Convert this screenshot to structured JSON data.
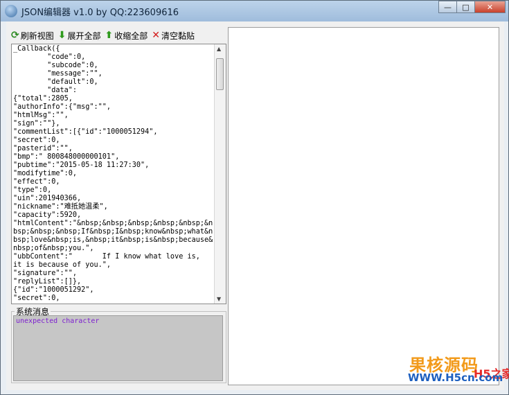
{
  "window": {
    "title": "JSON编辑器 v1.0  by  QQ:223609616",
    "minimize": "—",
    "maximize": "□",
    "close": "✕"
  },
  "toolbar": {
    "refresh_label": "刷新视图",
    "expand_label": "展开全部",
    "collapse_label": "收缩全部",
    "clear_label": "清空黏贴",
    "icons": {
      "refresh": "refresh-icon",
      "expand": "arrow-down-icon",
      "collapse": "arrow-up-icon",
      "clear": "close-icon"
    }
  },
  "editor": {
    "text": "_Callback({\n        \"code\":0,\n        \"subcode\":0,\n        \"message\":\"\",\n        \"default\":0,\n        \"data\":\n{\"total\":2805,\n\"authorInfo\":{\"msg\":\"\",\n\"htmlMsg\":\"\",\n\"sign\":\"\"},\n\"commentList\":[{\"id\":\"1000051294\",\n\"secret\":0,\n\"pasterid\":\"\",\n\"bmp\":\" 800848000000101\",\n\"pubtime\":\"2015-05-18 11:27:30\",\n\"modifytime\":0,\n\"effect\":0,\n\"type\":0,\n\"uin\":201940366,\n\"nickname\":\"难抵她温柔\",\n\"capacity\":5920,\n\"htmlContent\":\"&nbsp;&nbsp;&nbsp;&nbsp;&nbsp;&n\nbsp;&nbsp;&nbsp;If&nbsp;I&nbsp;know&nbsp;what&n\nbsp;love&nbsp;is,&nbsp;it&nbsp;is&nbsp;because&\nnbsp;of&nbsp;you.\",\n\"ubbContent\":\"       If I know what love is,\nit is because of you.\",\n\"signature\":\"\",\n\"replyList\":[]},\n{\"id\":\"1000051292\",\n\"secret\":0,"
  },
  "system": {
    "label": "系统消息",
    "message": "unexpected character"
  },
  "watermark": {
    "line1": "果核源码",
    "line2": "WWW.H5cn.com",
    "line3": "H5之家"
  },
  "colors": {
    "titlebar": "#a9c4e3",
    "error_text": "#7d1fd0",
    "close_button": "#c9412b"
  }
}
